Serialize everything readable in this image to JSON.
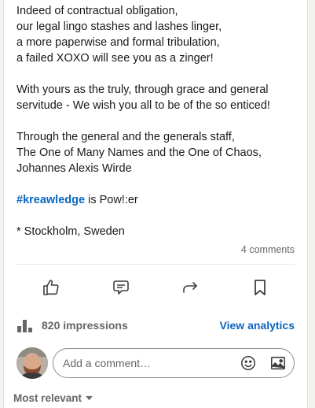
{
  "post": {
    "paragraphs": [
      "Indeed of contractual obligation,\nour legal lingo stashes and lashes linger,\na more paperwise and formal tribulation,\na failed XOXO will see you as a zinger!",
      "With yours as the truly, through grace and general servitude - We wish you all to be of the so enticed!",
      "Through the general and the generals staff,\nThe One of Many Names and the One of Chaos,\nJohannes Alexis Wirde"
    ],
    "hashtag": "#kreawledge",
    "hashtag_suffix": " is Pow!:er",
    "location": "* Stockholm, Sweden"
  },
  "social": {
    "comments_count": "4 comments"
  },
  "actions": [
    {
      "name": "like-button",
      "icon": "thumbs-up-icon"
    },
    {
      "name": "comment-button",
      "icon": "comment-icon"
    },
    {
      "name": "repost-button",
      "icon": "share-arrow-icon"
    },
    {
      "name": "save-button",
      "icon": "bookmark-icon"
    }
  ],
  "analytics": {
    "impressions": "820 impressions",
    "view_label": "View analytics"
  },
  "comment_box": {
    "placeholder": "Add a comment…",
    "icons": [
      "emoji-icon",
      "image-icon"
    ]
  },
  "sort": {
    "label": "Most relevant"
  },
  "colors": {
    "accent": "#0a66c2",
    "muted": "#666666"
  }
}
